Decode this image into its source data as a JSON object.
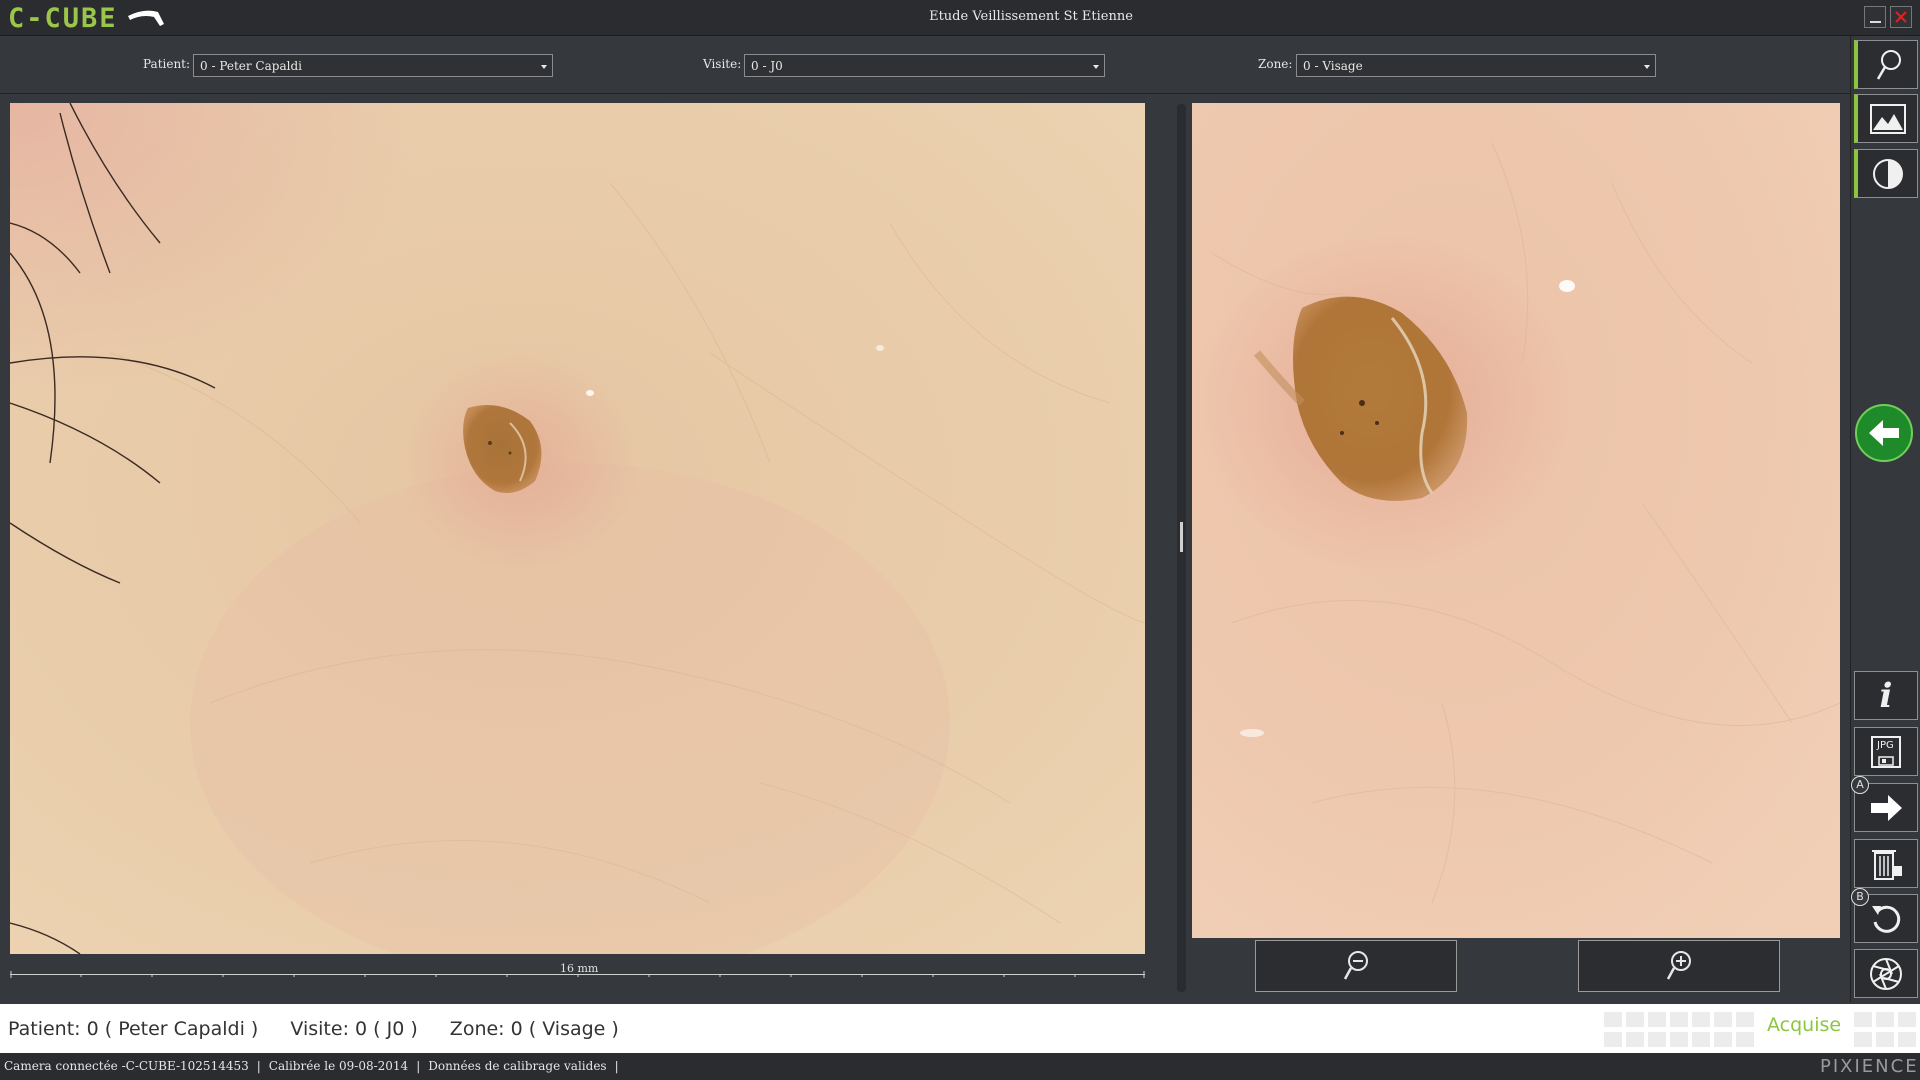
{
  "app": {
    "logo_text": "C-CUBE",
    "window_title": "Etude Veillissement St Etienne"
  },
  "selectors": {
    "patient": {
      "label": "Patient:",
      "value": "0  -  Peter Capaldi"
    },
    "visite": {
      "label": "Visite:",
      "value": "0  -  J0"
    },
    "zone": {
      "label": "Zone:",
      "value": "0  -  Visage"
    }
  },
  "viewer": {
    "scale_label": "16  mm"
  },
  "toolbar": {
    "items": [
      {
        "name": "magnifier-tool",
        "icon": "magnifier-icon",
        "active": true
      },
      {
        "name": "image-tool",
        "icon": "landscape-image-icon",
        "active": true
      },
      {
        "name": "contrast-tool",
        "icon": "contrast-icon",
        "active": true
      },
      {
        "name": "back-button",
        "icon": "arrow-left-icon"
      },
      {
        "name": "info-button",
        "icon": "info-icon"
      },
      {
        "name": "save-jpg-button",
        "icon": "jpg-save-icon"
      },
      {
        "name": "next-button",
        "icon": "arrow-right-icon",
        "badge": "A"
      },
      {
        "name": "delete-button",
        "icon": "trash-icon"
      },
      {
        "name": "reset-button",
        "icon": "rotate-icon",
        "badge": "B"
      },
      {
        "name": "capture-button",
        "icon": "aperture-icon"
      }
    ],
    "badge_a": "A",
    "badge_b": "B",
    "info_glyph": "i",
    "jpg_label": "JPG"
  },
  "info_bar": {
    "patient_label": "Patient:",
    "patient_value": "0 ( Peter Capaldi )",
    "visite_label": "Visite:",
    "visite_value": "0 ( J0 )",
    "zone_label": "Zone:",
    "zone_value": "0 ( Visage )",
    "status_label": "Acquise"
  },
  "status_bar": {
    "camera": "Camera connectée -C-CUBE-102514453",
    "calibration": "Calibrée le 09-08-2014",
    "calibration_data": "Données de calibrage valides",
    "separator": "|",
    "brand": "PIXIENCE"
  },
  "colors": {
    "accent": "#8cc63f",
    "back_button": "#1f8a2a",
    "close_red": "#e02020",
    "skin_base": "#e9cba8",
    "lesion": "#a8723a"
  }
}
